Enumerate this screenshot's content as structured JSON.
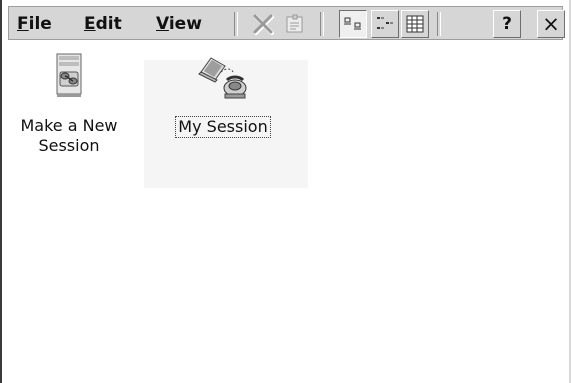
{
  "menu": {
    "file": {
      "mnemonic": "F",
      "rest": "ile"
    },
    "edit": {
      "mnemonic": "E",
      "rest": "dit"
    },
    "view": {
      "mnemonic": "V",
      "rest": "iew"
    }
  },
  "toolbar": {
    "buttons": [
      {
        "name": "delete",
        "icon": "delete-x-icon",
        "enabled": false
      },
      {
        "name": "properties",
        "icon": "properties-icon",
        "enabled": false
      },
      {
        "name": "large-icons-view",
        "icon": "large-icons-view-icon",
        "pressed": true
      },
      {
        "name": "small-icons-view",
        "icon": "small-icons-view-icon",
        "pressed": false
      },
      {
        "name": "details-view",
        "icon": "details-view-icon",
        "pressed": false
      }
    ],
    "help_label": "?",
    "close_label": "×"
  },
  "items": [
    {
      "label_line1": "Make a New",
      "label_line2": "Session",
      "icon": "new-session-icon"
    },
    {
      "label": "My Session",
      "icon": "session-connection-icon",
      "focused": true
    }
  ]
}
